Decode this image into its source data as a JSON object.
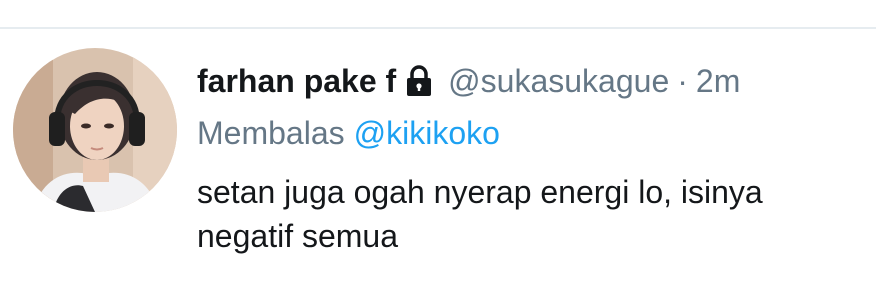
{
  "tweet": {
    "display_name": "farhan pake f",
    "protected_icon": "lock-icon",
    "handle": "@sukasukague",
    "separator": "·",
    "time": "2m",
    "reply_label": "Membalas",
    "reply_to": "@kikikoko",
    "text_line_1": "setan juga ogah nyerap energi lo, isinya",
    "text_line_2": "negatif semua"
  },
  "colors": {
    "primary_text": "#14171a",
    "secondary_text": "#657786",
    "mention": "#1da1f2",
    "divider": "#e6ecf0"
  }
}
